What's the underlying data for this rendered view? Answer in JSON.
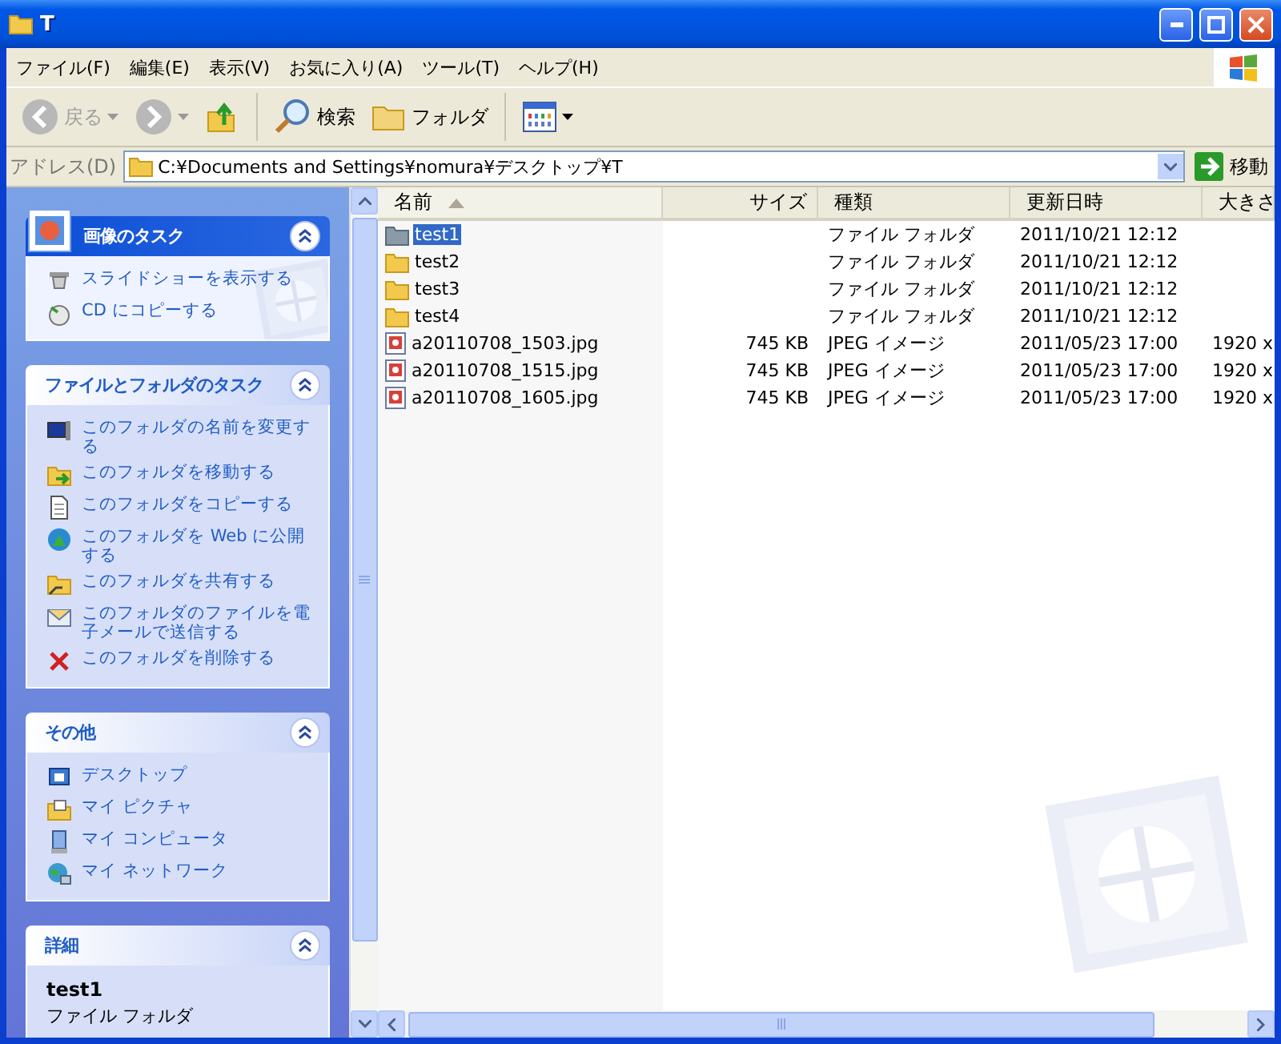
{
  "window": {
    "title": "T"
  },
  "menu": [
    {
      "label": "ファイル(F)"
    },
    {
      "label": "編集(E)"
    },
    {
      "label": "表示(V)"
    },
    {
      "label": "お気に入り(A)"
    },
    {
      "label": "ツール(T)"
    },
    {
      "label": "ヘルプ(H)"
    }
  ],
  "toolbar": [
    {
      "kind": "back",
      "label": "戻る",
      "disabled": true
    },
    {
      "kind": "forward",
      "disabled": true
    },
    {
      "kind": "up"
    },
    {
      "kind": "search",
      "label": "検索"
    },
    {
      "kind": "folders",
      "label": "フォルダ"
    },
    {
      "kind": "views"
    }
  ],
  "address": {
    "label": "アドレス(D)",
    "value": "C:¥Documents and Settings¥nomura¥デスクトップ¥T",
    "go": "移動"
  },
  "task_panels": [
    {
      "kind": "special",
      "title": "画像のタスク",
      "expanded": true,
      "items": [
        {
          "kind": "slideshow",
          "label": "スライドショーを表示する"
        },
        {
          "kind": "cd",
          "label": "CD にコピーする"
        }
      ]
    },
    {
      "kind": "normal",
      "title": "ファイルとフォルダのタスク",
      "expanded": true,
      "items": [
        {
          "kind": "rename",
          "label": "このフォルダの名前を変更する"
        },
        {
          "kind": "move",
          "label": "このフォルダを移動する"
        },
        {
          "kind": "copy",
          "label": "このフォルダをコピーする"
        },
        {
          "kind": "web",
          "label": "このフォルダを Web に公開する"
        },
        {
          "kind": "share",
          "label": "このフォルダを共有する"
        },
        {
          "kind": "mail",
          "label": "このフォルダのファイルを電子メールで送信する"
        },
        {
          "kind": "delete",
          "label": "このフォルダを削除する"
        }
      ]
    },
    {
      "kind": "normal",
      "title": "その他",
      "expanded": true,
      "items": [
        {
          "kind": "desktop",
          "label": "デスクトップ"
        },
        {
          "kind": "pictures",
          "label": "マイ ピクチャ"
        },
        {
          "kind": "computer",
          "label": "マイ コンピュータ"
        },
        {
          "kind": "network",
          "label": "マイ ネットワーク"
        }
      ]
    },
    {
      "kind": "details",
      "title": "詳細",
      "expanded": true,
      "name": "test1",
      "type": "ファイル フォルダ"
    }
  ],
  "columns": [
    {
      "label": "名前",
      "sorted": true
    },
    {
      "label": "サイズ",
      "sorted": false
    },
    {
      "label": "種類",
      "sorted": false
    },
    {
      "label": "更新日時",
      "sorted": false
    },
    {
      "label": "大きさ",
      "sorted": false
    }
  ],
  "rows": [
    {
      "kind": "folder",
      "name": "test1",
      "type": "ファイル フォルダ",
      "modified": "2011/10/21 12:12",
      "selected": true
    },
    {
      "kind": "folder",
      "name": "test2",
      "type": "ファイル フォルダ",
      "modified": "2011/10/21 12:12",
      "selected": false
    },
    {
      "kind": "folder",
      "name": "test3",
      "type": "ファイル フォルダ",
      "modified": "2011/10/21 12:12",
      "selected": false
    },
    {
      "kind": "folder",
      "name": "test4",
      "type": "ファイル フォルダ",
      "modified": "2011/10/21 12:12",
      "selected": false
    },
    {
      "kind": "image",
      "name": "a20110708_1503.jpg",
      "size": "745 KB",
      "type": "JPEG イメージ",
      "modified": "2011/05/23 17:00",
      "column_5": "1920 x",
      "selected": false
    },
    {
      "kind": "image",
      "name": "a20110708_1515.jpg",
      "size": "745 KB",
      "type": "JPEG イメージ",
      "modified": "2011/05/23 17:00",
      "column_5": "1920 x",
      "selected": false
    },
    {
      "kind": "image",
      "name": "a20110708_1605.jpg",
      "size": "745 KB",
      "type": "JPEG イメージ",
      "modified": "2011/05/23 17:00",
      "column_5": "1920 x",
      "selected": false
    }
  ]
}
